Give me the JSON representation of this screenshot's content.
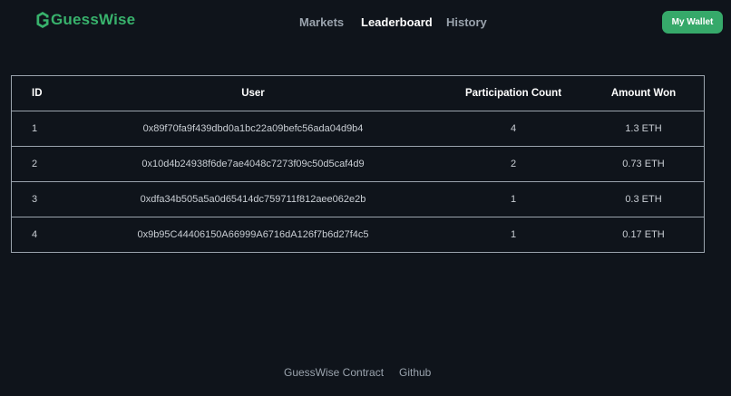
{
  "brand": {
    "name": "GuessWise",
    "accent_color": "#38b26c",
    "logo_icon": "hexagon-g-icon"
  },
  "nav": {
    "items": [
      {
        "label": "Markets",
        "active": false
      },
      {
        "label": "Leaderboard",
        "active": true
      },
      {
        "label": "History",
        "active": false
      }
    ]
  },
  "wallet": {
    "label": "My Wallet",
    "color": "#36a96a"
  },
  "leaderboard": {
    "columns": [
      "ID",
      "User",
      "Participation Count",
      "Amount Won"
    ],
    "rows": [
      {
        "id": "1",
        "user": "0x89f70fa9f439dbd0a1bc22a09befc56ada04d9b4",
        "count": "4",
        "amount": "1.3 ETH"
      },
      {
        "id": "2",
        "user": "0x10d4b24938f6de7ae4048c7273f09c50d5caf4d9",
        "count": "2",
        "amount": "0.73 ETH"
      },
      {
        "id": "3",
        "user": "0xdfa34b505a5a0d65414dc759711f812aee062e2b",
        "count": "1",
        "amount": "0.3 ETH"
      },
      {
        "id": "4",
        "user": "0x9b95C44406150A66999A6716dA126f7b6d27f4c5",
        "count": "1",
        "amount": "0.17 ETH"
      }
    ]
  },
  "footer": {
    "links": [
      "GuessWise Contract",
      "Github"
    ]
  }
}
